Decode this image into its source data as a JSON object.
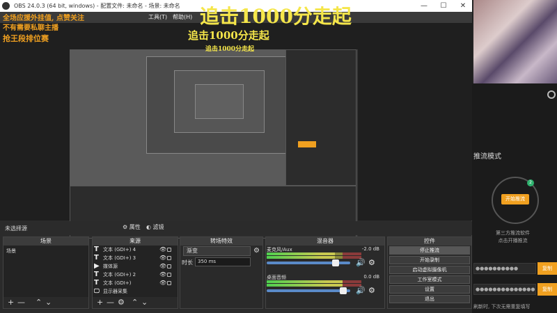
{
  "window": {
    "title": "OBS 24.0.3 (64 bit, windows) - 配置文件: 未命名 - 场景: 未命名",
    "min": "—",
    "max": "☐",
    "close": "✕"
  },
  "menu": [
    "工具(T)",
    "帮助(H)"
  ],
  "overlay": {
    "big_title": "追击1000分走起",
    "mid_title": "追击1000分走起",
    "small_title": "追击1000分走起",
    "left_line1": "全场应援外挂值, 点赞关注",
    "left_line2": "不有需要私聊主播",
    "left_line3": "抢王段排位赛"
  },
  "scene_bar": {
    "label": "未选择源",
    "props": "属性",
    "filters": "滤镜"
  },
  "docks": {
    "scenes": {
      "title": "场景",
      "items": [
        "场景"
      ]
    },
    "sources": {
      "title": "来源",
      "items": [
        {
          "icon": "T",
          "name": "文本 (GDI+) 4"
        },
        {
          "icon": "T",
          "name": "文本 (GDI+) 3"
        },
        {
          "icon": "▶",
          "name": "媒体源"
        },
        {
          "icon": "T",
          "name": "文本 (GDI+) 2"
        },
        {
          "icon": "T",
          "name": "文本 (GDI+)"
        },
        {
          "icon": "🖵",
          "name": "显示器采集"
        }
      ]
    },
    "transitions": {
      "title": "转场特效",
      "selected": "渐变",
      "duration_label": "时长",
      "duration_value": "350 ms"
    },
    "mixer": {
      "title": "混音器",
      "channels": [
        {
          "name": "麦克风/Aux",
          "db": "-2.0 dB",
          "level": 0.72,
          "volume": 0.85
        },
        {
          "name": "桌面音频",
          "db": "0.0 dB",
          "level": 0.8,
          "volume": 0.95
        }
      ]
    },
    "controls": {
      "title": "控件",
      "buttons": [
        "停止推流",
        "开始录制",
        "启动虚拟摄像机",
        "工作室模式",
        "设置",
        "退出"
      ]
    },
    "foot": {
      "add": "+",
      "remove": "—",
      "up": "⌃",
      "down": "⌄",
      "gear": "⚙"
    }
  },
  "stream_app": {
    "mode_label": "推流模式",
    "start_button": "开始推流",
    "badge": "2",
    "note_line1": "第三方推流软件",
    "note_line2": "点击开播推流",
    "field1": "●●●●●●●●●●",
    "field2": "●●●●●●●●●●●●●●",
    "copy_label": "复制",
    "hint": "刷新时, 下次无需重复填写"
  },
  "colors": {
    "overlay_yellow": "#f5e64a",
    "overlay_orange": "#f0a020",
    "accent_green": "#2fb36f"
  }
}
